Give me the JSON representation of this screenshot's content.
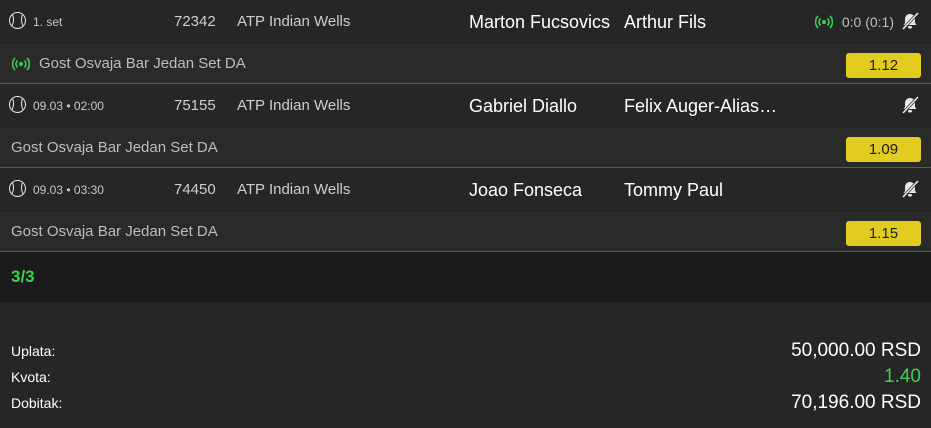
{
  "matches": [
    {
      "time": "1. set",
      "code": "72342",
      "league": "ATP Indian Wells",
      "home": "Marton Fucsovics",
      "away": "Arthur Fils",
      "score": "0:0 (0:1)",
      "live": true,
      "bet_label": "Gost Osvaja Bar Jedan Set DA",
      "odd": "1.12"
    },
    {
      "time": "09.03 • 02:00",
      "code": "75155",
      "league": "ATP Indian Wells",
      "home": "Gabriel Diallo",
      "away": "Felix Auger-Aliassime",
      "score": "",
      "live": false,
      "bet_label": "Gost Osvaja Bar Jedan Set DA",
      "odd": "1.09"
    },
    {
      "time": "09.03 • 03:30",
      "code": "74450",
      "league": "ATP Indian Wells",
      "home": "Joao Fonseca",
      "away": "Tommy Paul",
      "score": "",
      "live": false,
      "bet_label": "Gost Osvaja Bar Jedan Set DA",
      "odd": "1.15"
    }
  ],
  "count": "3/3",
  "summary": {
    "stake_label": "Uplata:",
    "stake_value": "50,000.00 RSD",
    "odds_label": "Kvota:",
    "odds_value": "1.40",
    "win_label": "Dobitak:",
    "win_value": "70,196.00 RSD"
  },
  "colors": {
    "accent_green": "#3ed14f",
    "odd_yellow": "#e2cc1d"
  },
  "icons": {
    "sport": "tennis-ball-icon",
    "live": "live-broadcast-icon",
    "notifications": "bell-off-icon"
  }
}
